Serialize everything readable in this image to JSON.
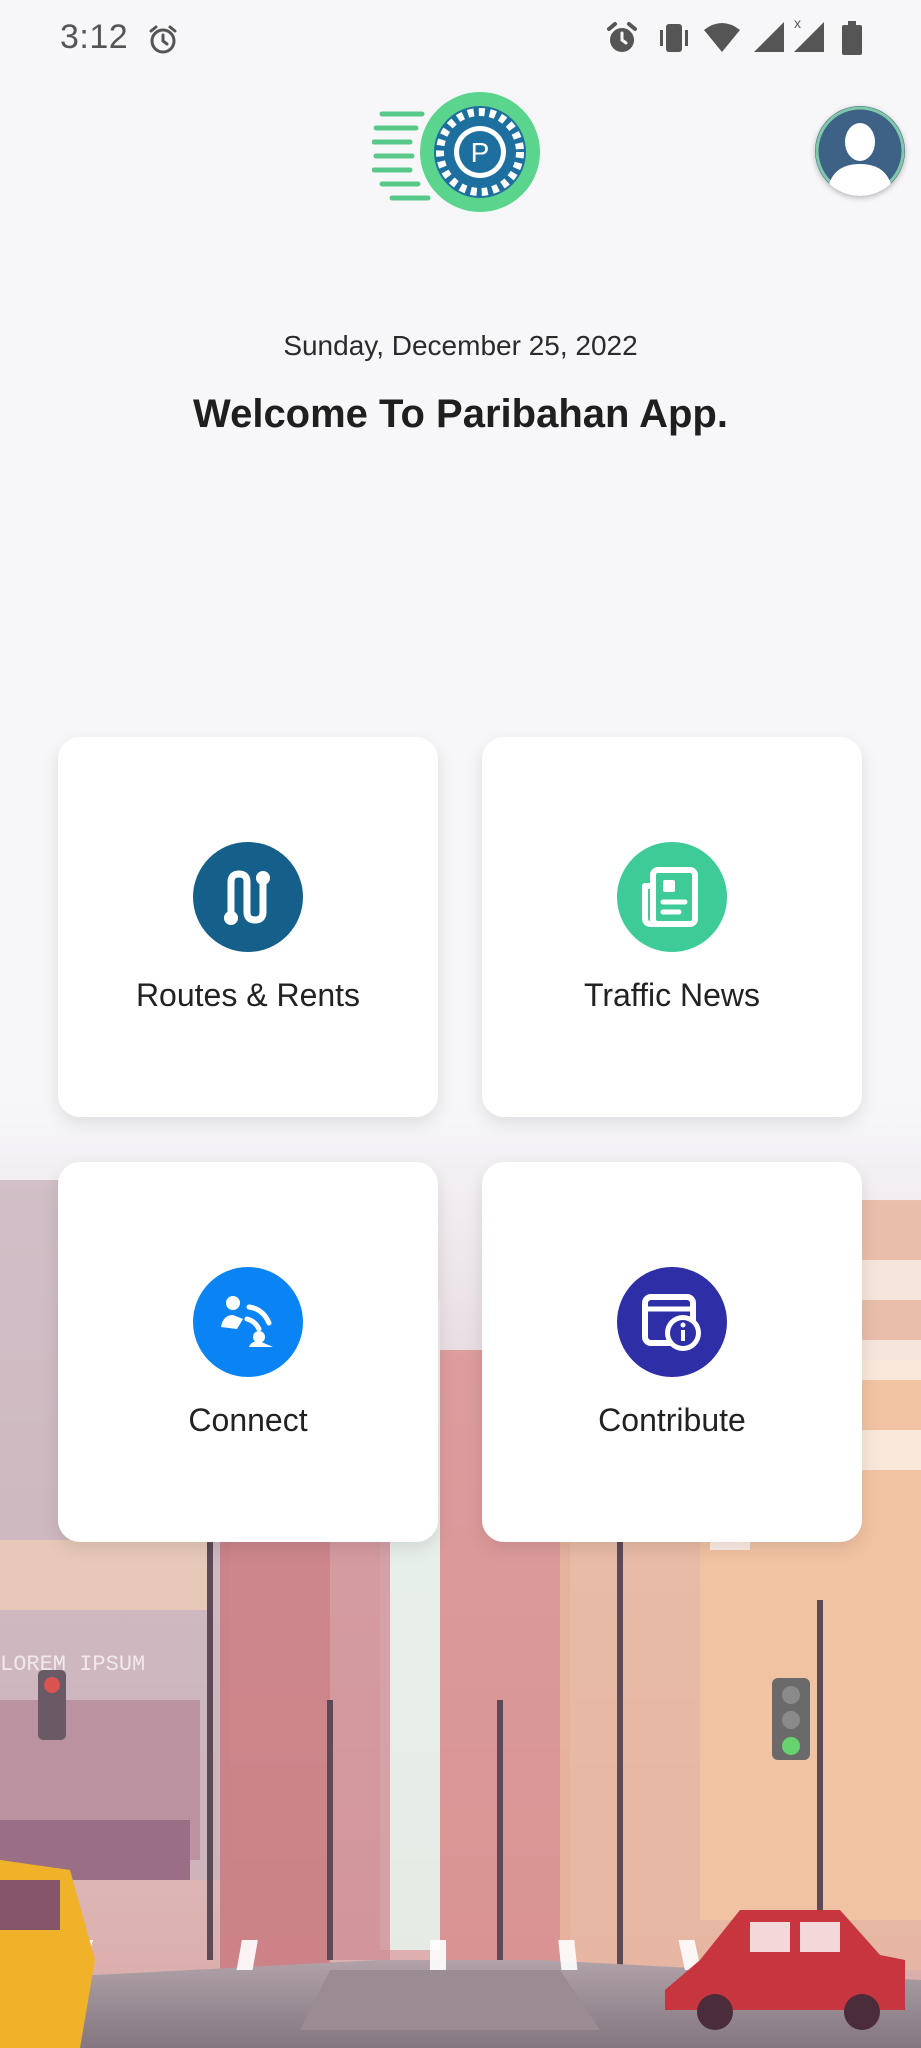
{
  "status_bar": {
    "time": "3:12",
    "icons": [
      "alarm-icon",
      "vibrate-icon",
      "wifi-icon",
      "signal-icon",
      "signal-x-icon",
      "battery-icon"
    ]
  },
  "header": {
    "logo": "paribahan-logo",
    "avatar": "profile-avatar",
    "date": "Sunday, December 25, 2022",
    "welcome": "Welcome To Paribahan App."
  },
  "cards": [
    {
      "label": "Routes & Rents",
      "icon": "route-icon",
      "color": "#15608a"
    },
    {
      "label": "Traffic News",
      "icon": "newspaper-icon",
      "color": "#3ecb98"
    },
    {
      "label": "Connect",
      "icon": "connect-icon",
      "color": "#0a84f5"
    },
    {
      "label": "Contribute",
      "icon": "info-card-icon",
      "color": "#2e2fa6"
    }
  ]
}
